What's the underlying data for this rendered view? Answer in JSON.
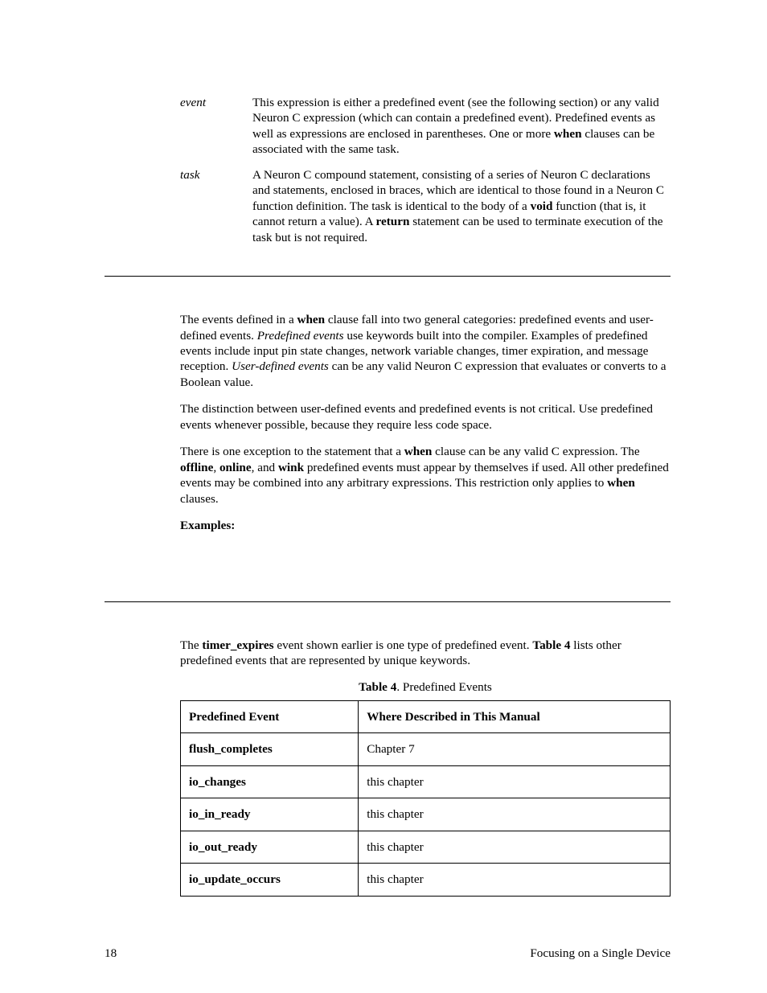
{
  "definitions": [
    {
      "term": "event",
      "pre": "This expression is either a predefined event (see the following section) or any valid Neuron C expression (which can contain a predefined event).  Predefined events as well as expressions are enclosed in parentheses.  One or more ",
      "bold1": "when",
      "post": " clauses can be associated with the same task."
    },
    {
      "term": "task",
      "pre": "A Neuron C compound statement, consisting of a series of Neuron C declarations and statements, enclosed in braces, which are identical to those found in a Neuron C function definition.  The task is identical to the body of a ",
      "bold1": "void",
      "mid": " function (that is, it cannot return a value).  A ",
      "bold2": "return",
      "post": " statement can be used to terminate execution of the task but is not required."
    }
  ],
  "paragraphs": {
    "p1": {
      "s1": "The events defined in a ",
      "b1": "when",
      "s2": " clause fall into two general categories:  predefined events and user-defined events.  ",
      "i1": "Predefined events",
      "s3": " use keywords built into the compiler.  Examples of predefined events include input pin state changes, network variable changes, timer expiration, and message reception.  ",
      "i2": "User-defined events",
      "s4": " can be any valid Neuron C expression that evaluates or converts to a Boolean value."
    },
    "p2": "The distinction between user-defined events and predefined events is not critical.  Use predefined events whenever possible, because they require less code space.",
    "p3": {
      "s1": "There is one exception to the statement that a ",
      "b1": "when",
      "s2": " clause can be any valid C expression.  The ",
      "b2": "offline",
      "s3": ", ",
      "b3": "online",
      "s4": ", and ",
      "b4": "wink",
      "s5": " predefined events must appear by themselves if used.  All other predefined events may be combined into any arbitrary expressions.  This restriction only applies to ",
      "b5": "when",
      "s6": " clauses."
    },
    "examples_label": "Examples:",
    "p4": {
      "s1": "The ",
      "b1": "timer_expires",
      "s2": " event shown earlier is one type of predefined event.  ",
      "b2": "Table 4",
      "s3": " lists other predefined events that are represented by unique keywords."
    }
  },
  "table": {
    "caption_bold": "Table 4",
    "caption_rest": ". Predefined Events",
    "header_left": "Predefined Event",
    "header_right": "Where Described in This Manual",
    "rows": [
      {
        "event": "flush_completes",
        "where": "Chapter 7"
      },
      {
        "event": "io_changes",
        "where": "this chapter"
      },
      {
        "event": "io_in_ready",
        "where": "this chapter"
      },
      {
        "event": "io_out_ready",
        "where": "this chapter"
      },
      {
        "event": "io_update_occurs",
        "where": "this chapter"
      }
    ]
  },
  "footer": {
    "page_number": "18",
    "running_title": "Focusing on a Single Device"
  }
}
